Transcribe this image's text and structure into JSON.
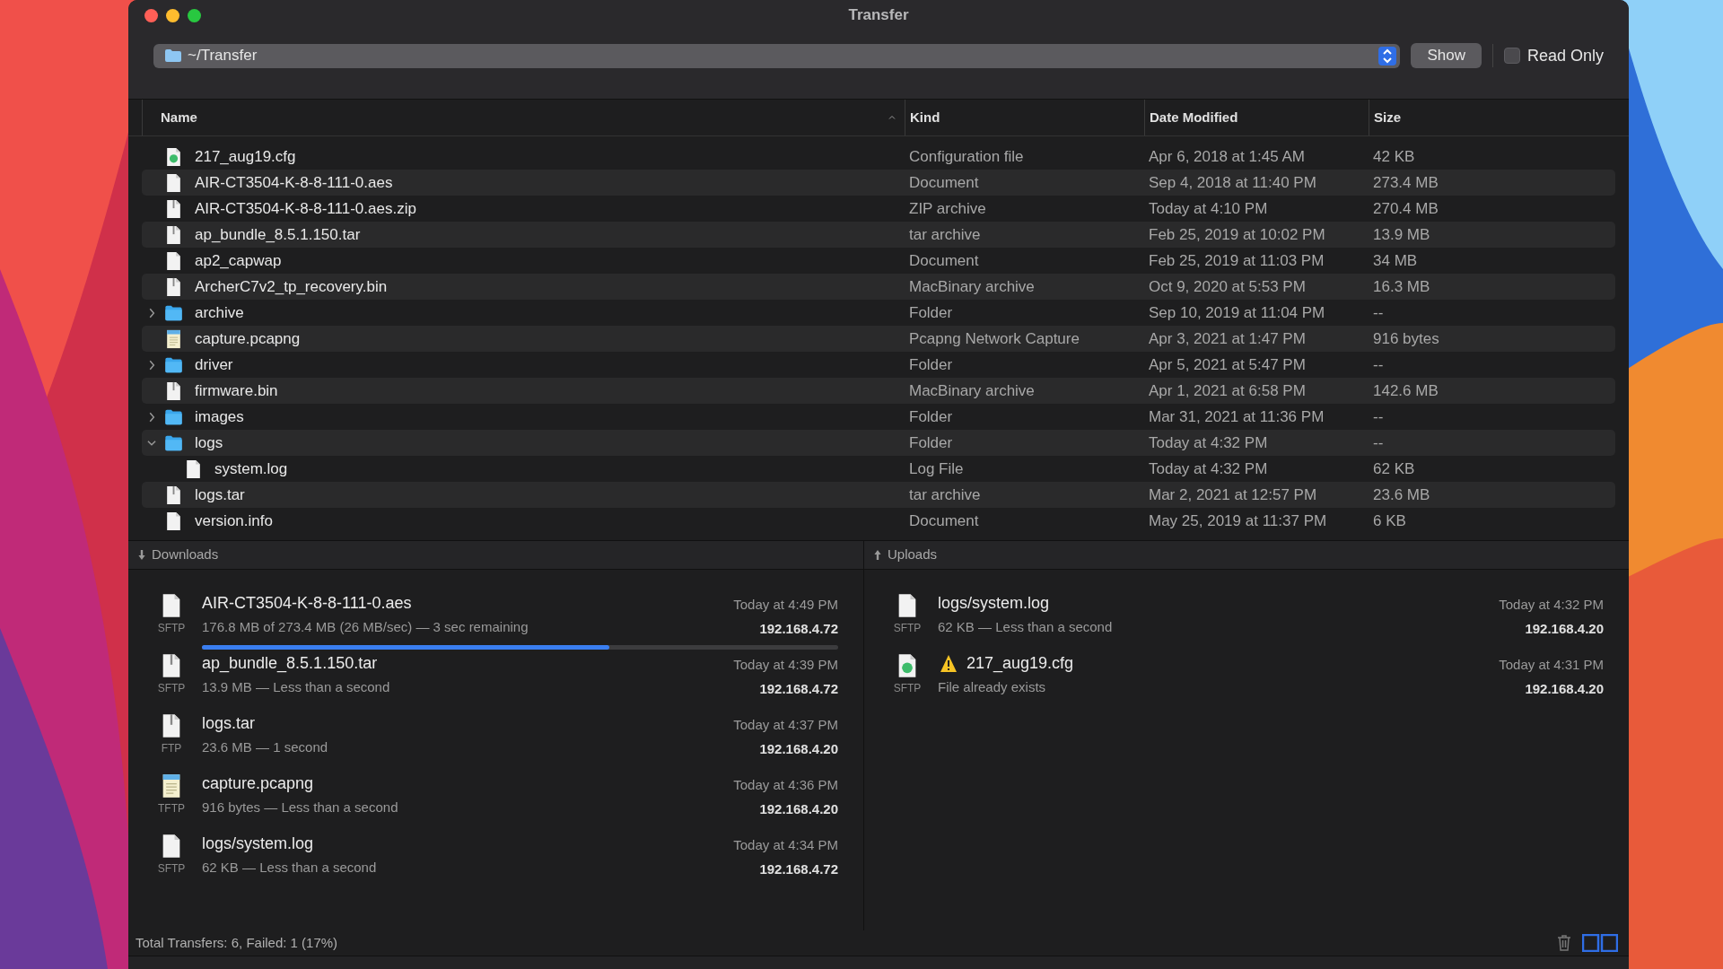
{
  "window": {
    "title": "Transfer"
  },
  "toolbar": {
    "path": "~/Transfer",
    "show_button": "Show",
    "read_only": {
      "label": "Read Only",
      "checked": false
    }
  },
  "file_list": {
    "columns": [
      {
        "label": "Name",
        "sorted": true
      },
      {
        "label": "Kind",
        "sorted": false
      },
      {
        "label": "Date Modified",
        "sorted": false
      },
      {
        "label": "Size",
        "sorted": false
      }
    ],
    "rows": [
      {
        "name": "217_aug19.cfg",
        "kind": "config",
        "file_kind": "Configuration file",
        "date_modified": "Apr 6, 2018 at 1:45 AM",
        "size": "42 KB"
      },
      {
        "name": "AIR-CT3504-K-8-8-111-0.aes",
        "kind": "document",
        "file_kind": "Document",
        "date_modified": "Sep 4, 2018 at 11:40 PM",
        "size": "273.4 MB"
      },
      {
        "name": "AIR-CT3504-K-8-8-111-0.aes.zip",
        "kind": "archive",
        "file_kind": "ZIP archive",
        "date_modified": "Today at 4:10 PM",
        "size": "270.4 MB"
      },
      {
        "name": "ap_bundle_8.5.1.150.tar",
        "kind": "archive",
        "file_kind": "tar archive",
        "date_modified": "Feb 25, 2019 at 10:02 PM",
        "size": "13.9 MB"
      },
      {
        "name": "ap2_capwap",
        "kind": "document",
        "file_kind": "Document",
        "date_modified": "Feb 25, 2019 at 11:03 PM",
        "size": "34 MB"
      },
      {
        "name": "ArcherC7v2_tp_recovery.bin",
        "kind": "archive",
        "file_kind": "MacBinary archive",
        "date_modified": "Oct 9, 2020 at 5:53 PM",
        "size": "16.3 MB"
      },
      {
        "name": "archive",
        "kind": "folder",
        "expanded": false,
        "file_kind": "Folder",
        "date_modified": "Sep 10, 2019 at 11:04 PM",
        "size": "--"
      },
      {
        "name": "capture.pcapng",
        "kind": "capture",
        "file_kind": "Pcapng Network Capture",
        "date_modified": "Apr 3, 2021 at 1:47 PM",
        "size": "916 bytes"
      },
      {
        "name": "driver",
        "kind": "folder",
        "expanded": false,
        "file_kind": "Folder",
        "date_modified": "Apr 5, 2021 at 5:47 PM",
        "size": "--"
      },
      {
        "name": "firmware.bin",
        "kind": "archive",
        "file_kind": "MacBinary archive",
        "date_modified": "Apr 1, 2021 at 6:58 PM",
        "size": "142.6 MB"
      },
      {
        "name": "images",
        "kind": "folder",
        "expanded": false,
        "file_kind": "Folder",
        "date_modified": "Mar 31, 2021 at 11:36 PM",
        "size": "--"
      },
      {
        "name": "logs",
        "kind": "folder",
        "expanded": true,
        "file_kind": "Folder",
        "date_modified": "Today at 4:32 PM",
        "size": "--",
        "children": [
          {
            "name": "system.log",
            "kind": "document",
            "file_kind": "Log File",
            "date_modified": "Today at 4:32 PM",
            "size": "62 KB"
          }
        ]
      },
      {
        "name": "logs.tar",
        "kind": "archive",
        "file_kind": "tar archive",
        "date_modified": "Mar 2, 2021 at 12:57 PM",
        "size": "23.6 MB"
      },
      {
        "name": "version.info",
        "kind": "document",
        "file_kind": "Document",
        "date_modified": "May 25, 2019 at 11:37 PM",
        "size": "6 KB"
      }
    ]
  },
  "downloads": {
    "title": "Downloads",
    "items": [
      {
        "name": "AIR-CT3504-K-8-8-111-0.aes",
        "kind": "document",
        "protocol": "SFTP",
        "detail": "176.8 MB of 273.4 MB (26 MB/sec) — 3 sec remaining",
        "time": "Today at 4:49 PM",
        "host": "192.168.4.72",
        "warning": false,
        "level": 0.64
      },
      {
        "name": "ap_bundle_8.5.1.150.tar",
        "kind": "archive",
        "protocol": "SFTP",
        "detail": "13.9 MB — Less than a second",
        "time": "Today at 4:39 PM",
        "host": "192.168.4.72",
        "warning": false
      },
      {
        "name": "logs.tar",
        "kind": "archive",
        "protocol": "FTP",
        "detail": "23.6 MB — 1 second",
        "time": "Today at 4:37 PM",
        "host": "192.168.4.20",
        "warning": false
      },
      {
        "name": "capture.pcapng",
        "kind": "capture",
        "protocol": "TFTP",
        "detail": "916 bytes — Less than a second",
        "time": "Today at 4:36 PM",
        "host": "192.168.4.20",
        "warning": false
      },
      {
        "name": "logs/system.log",
        "kind": "document",
        "protocol": "SFTP",
        "detail": "62 KB — Less than a second",
        "time": "Today at 4:34 PM",
        "host": "192.168.4.72",
        "warning": false
      }
    ]
  },
  "uploads": {
    "title": "Uploads",
    "items": [
      {
        "name": "logs/system.log",
        "kind": "document",
        "protocol": "SFTP",
        "detail": "62 KB — Less than a second",
        "time": "Today at 4:32 PM",
        "host": "192.168.4.20",
        "warning": false
      },
      {
        "name": "217_aug19.cfg",
        "kind": "config",
        "protocol": "SFTP",
        "detail": "File already exists",
        "time": "Today at 4:31 PM",
        "host": "192.168.4.20",
        "warning": true
      }
    ]
  },
  "status_bar": {
    "text": "Total Transfers: 6, Failed: 1 (17%)"
  }
}
